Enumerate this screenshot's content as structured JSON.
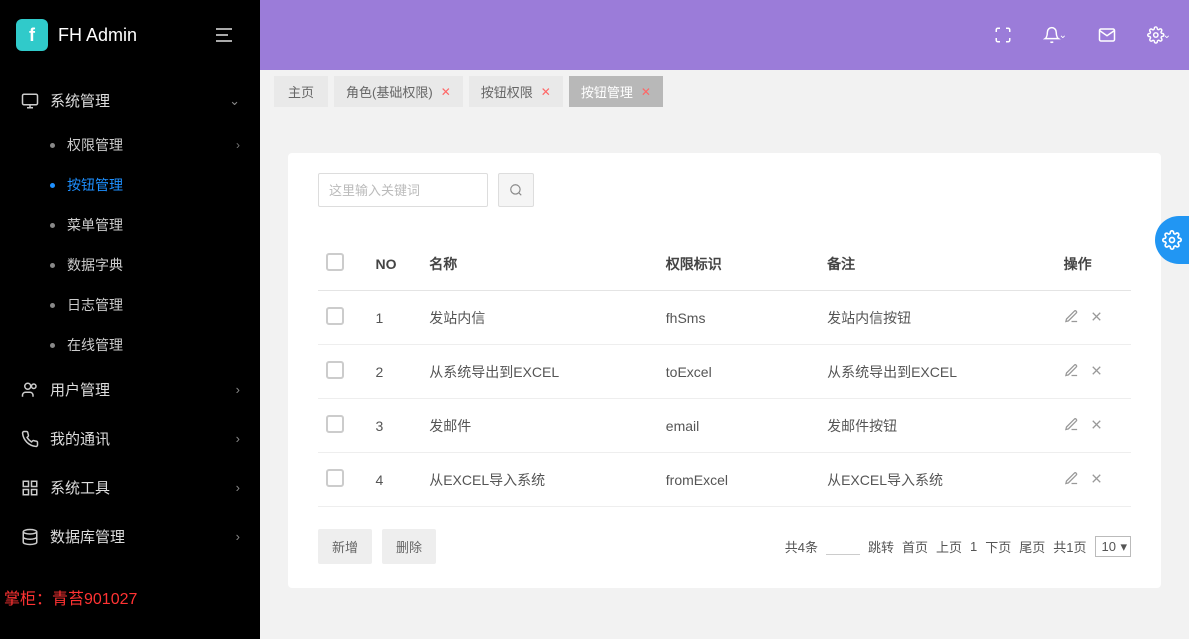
{
  "brand": {
    "logo_text": "f",
    "title": "FH Admin"
  },
  "sidebar": {
    "groups": [
      {
        "label": "系统管理",
        "icon": "monitor",
        "expanded": true,
        "items": [
          {
            "label": "权限管理",
            "has_sub": true
          },
          {
            "label": "按钮管理",
            "active": true
          },
          {
            "label": "菜单管理"
          },
          {
            "label": "数据字典"
          },
          {
            "label": "日志管理"
          },
          {
            "label": "在线管理"
          }
        ]
      },
      {
        "label": "用户管理",
        "icon": "users"
      },
      {
        "label": "我的通讯",
        "icon": "phone"
      },
      {
        "label": "系统工具",
        "icon": "grid"
      },
      {
        "label": "数据库管理",
        "icon": "database"
      }
    ]
  },
  "footer_watermark": "掌柜：青苔901027",
  "tabs": [
    {
      "label": "主页",
      "closable": false
    },
    {
      "label": "角色(基础权限)",
      "closable": true
    },
    {
      "label": "按钮权限",
      "closable": true
    },
    {
      "label": "按钮管理",
      "closable": true,
      "active": true
    }
  ],
  "search": {
    "placeholder": "这里输入关键词"
  },
  "table": {
    "headers": {
      "no": "NO",
      "name": "名称",
      "perm": "权限标识",
      "remark": "备注",
      "actions": "操作"
    },
    "rows": [
      {
        "no": "1",
        "name": "发站内信",
        "perm": "fhSms",
        "remark": "发站内信按钮"
      },
      {
        "no": "2",
        "name": "从系统导出到EXCEL",
        "perm": "toExcel",
        "remark": "从系统导出到EXCEL"
      },
      {
        "no": "3",
        "name": "发邮件",
        "perm": "email",
        "remark": "发邮件按钮"
      },
      {
        "no": "4",
        "name": "从EXCEL导入系统",
        "perm": "fromExcel",
        "remark": "从EXCEL导入系统"
      }
    ]
  },
  "footer_buttons": {
    "add": "新增",
    "delete": "删除"
  },
  "pager": {
    "total_text": "共4条",
    "jump_label": "跳转",
    "first": "首页",
    "prev": "上页",
    "current": "1",
    "next": "下页",
    "last": "尾页",
    "total_pages": "共1页",
    "page_size": "10"
  }
}
